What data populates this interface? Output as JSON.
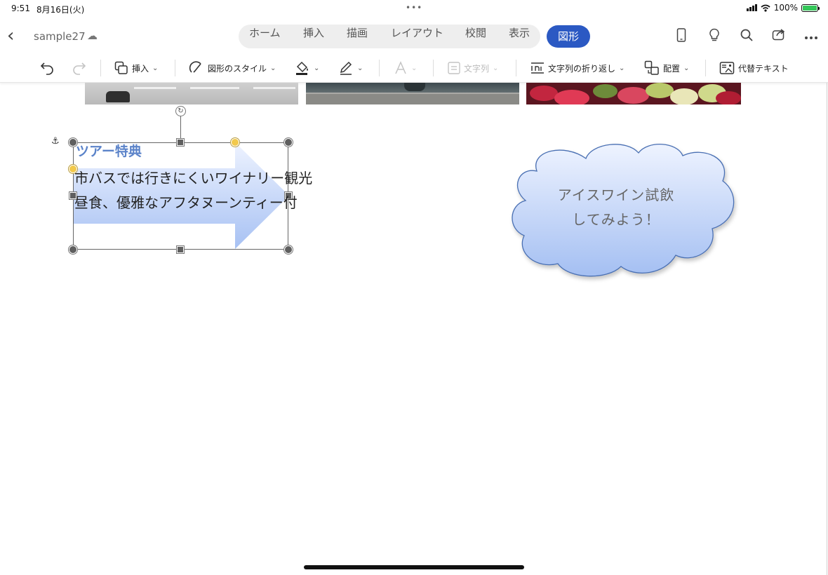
{
  "status_bar": {
    "time": "9:51",
    "date": "8月16日(火)",
    "dots": "•••",
    "battery": "100%"
  },
  "title_bar": {
    "back_icon": "chevron-left-icon",
    "doc_name": "sample27",
    "tabs": [
      "ホーム",
      "挿入",
      "描画",
      "レイアウト",
      "校閲",
      "表示"
    ],
    "active_tab": "図形",
    "icons": [
      "phone-view-icon",
      "lightbulb-icon",
      "search-icon",
      "share-icon",
      "more-icon"
    ]
  },
  "ribbon": {
    "insert": "挿入",
    "shape_style": "図形のスタイル",
    "text_direction": "文字列",
    "wrap_text": "文字列の折り返し",
    "arrange": "配置",
    "alt_text": "代替テキスト"
  },
  "document": {
    "shape_title": "ツアー特典",
    "shape_line1": "市バスでは行きにくいワイナリー観光",
    "shape_line2": "昼食、優雅なアフタヌーンティー付",
    "cloud_line1": "アイスワイン試飲",
    "cloud_line2": "してみよう！"
  },
  "colors": {
    "accent": "#2b59c3",
    "shape_title": "#5b83c9",
    "shape_fill_light": "#e6eeff",
    "shape_fill_dark": "#a4bff2"
  }
}
